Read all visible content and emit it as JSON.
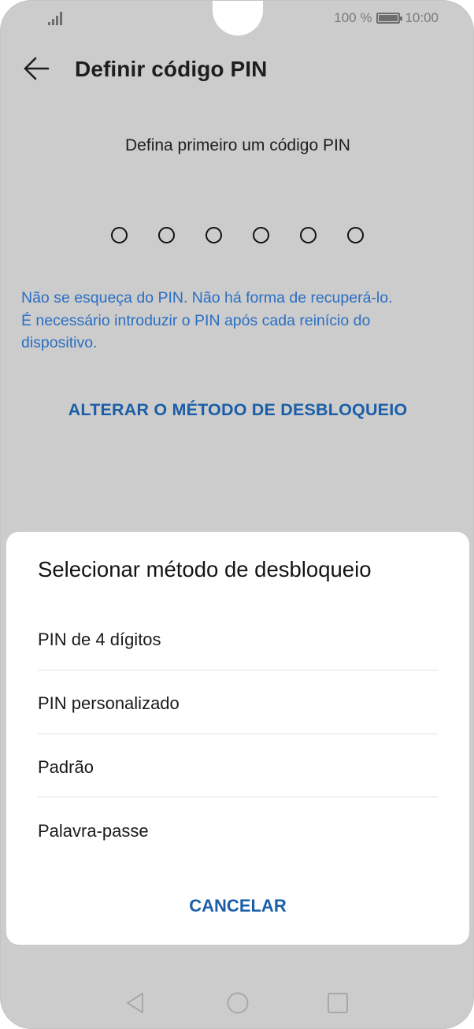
{
  "status_bar": {
    "battery_percent": "100 %",
    "time": "10:00",
    "icons": [
      "signal-icon",
      "battery-icon"
    ]
  },
  "header": {
    "title": "Definir código PIN",
    "back_icon": "back-arrow-icon"
  },
  "pin_screen": {
    "subtitle": "Defina primeiro um código PIN",
    "pin_length": 6,
    "warning_lines": [
      "Não se esqueça do PIN. Não há forma de recuperá-lo.",
      "É necessário introduzir o PIN após cada reinício do",
      "dispositivo."
    ],
    "change_method_label": "ALTERAR O MÉTODO DE DESBLOQUEIO"
  },
  "dialog": {
    "title": "Selecionar método de desbloqueio",
    "options": [
      {
        "label": "PIN de 4 dígitos"
      },
      {
        "label": "PIN personalizado"
      },
      {
        "label": "Padrão"
      },
      {
        "label": "Palavra-passe"
      }
    ],
    "cancel_label": "CANCELAR"
  },
  "navbar": {
    "icons": [
      "nav-back-icon",
      "nav-home-icon",
      "nav-recents-icon"
    ]
  },
  "colors": {
    "overlay_background": "#cccccc",
    "accent_blue": "#1a5ea8",
    "warning_blue": "#2a6fc4",
    "dialog_background": "#ffffff"
  }
}
